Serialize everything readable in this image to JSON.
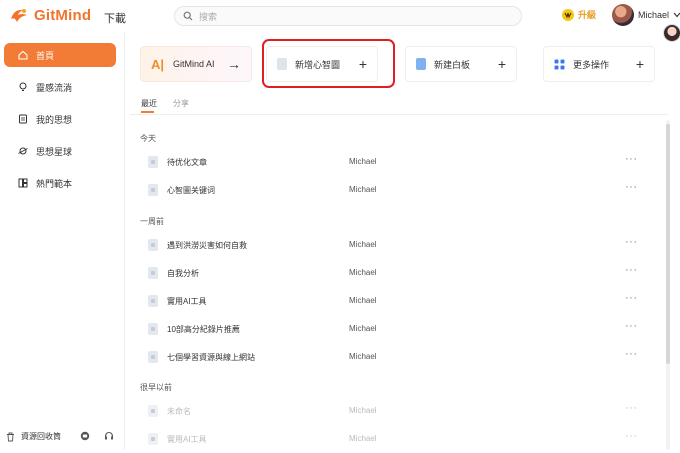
{
  "header": {
    "brand": "GitMind",
    "download": "下載",
    "search_placeholder": "搜索",
    "upgrade": "升級",
    "user_name": "Michael"
  },
  "sidebar": {
    "items": [
      {
        "label": "首頁",
        "icon": "home-icon"
      },
      {
        "label": "靈感流淌",
        "icon": "lightbulb-icon"
      },
      {
        "label": "我的思想",
        "icon": "document-icon"
      },
      {
        "label": "思想星球",
        "icon": "planet-icon"
      },
      {
        "label": "熱門範本",
        "icon": "template-icon"
      }
    ],
    "trash": "資源回收筒"
  },
  "cards": {
    "ai": "GitMind AI",
    "new_mindmap": "新增心智圖",
    "new_whiteboard": "新建白板",
    "more": "更多操作"
  },
  "tabs": [
    "最近",
    "分享"
  ],
  "sections": {
    "today": "今天",
    "week": "一周前",
    "earlier": "很早以前"
  },
  "rows": {
    "today": [
      {
        "name": "待优化文章",
        "owner": "Michael"
      },
      {
        "name": "心智圖关键词",
        "owner": "Michael"
      }
    ],
    "week": [
      {
        "name": "遇到洪澇災害如何自救",
        "owner": "Michael"
      },
      {
        "name": "自我分析",
        "owner": "Michael"
      },
      {
        "name": "實用AI工具",
        "owner": "Michael"
      },
      {
        "name": "10部高分紀錄片推薦",
        "owner": "Michael"
      },
      {
        "name": "七個學習資源與線上網站",
        "owner": "Michael"
      }
    ],
    "earlier": [
      {
        "name": "未命名",
        "owner": "Michael"
      },
      {
        "name": "實用AI工具",
        "owner": "Michael"
      }
    ]
  },
  "more_glyph": "···",
  "colors": {
    "accent": "#f27b35",
    "highlight": "#e02020"
  }
}
